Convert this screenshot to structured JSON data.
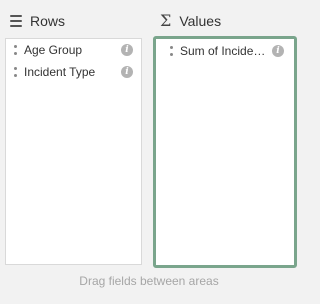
{
  "rows": {
    "title": "Rows",
    "icon": "hamburger-icon",
    "items": [
      {
        "label": "Age Group"
      },
      {
        "label": "Incident Type"
      }
    ]
  },
  "values": {
    "title": "Values",
    "icon": "sigma-icon",
    "items": [
      {
        "label": "Sum of Incident Count"
      }
    ],
    "highlight_color": "#7aa58c"
  },
  "footer": {
    "hint": "Drag fields between areas"
  }
}
